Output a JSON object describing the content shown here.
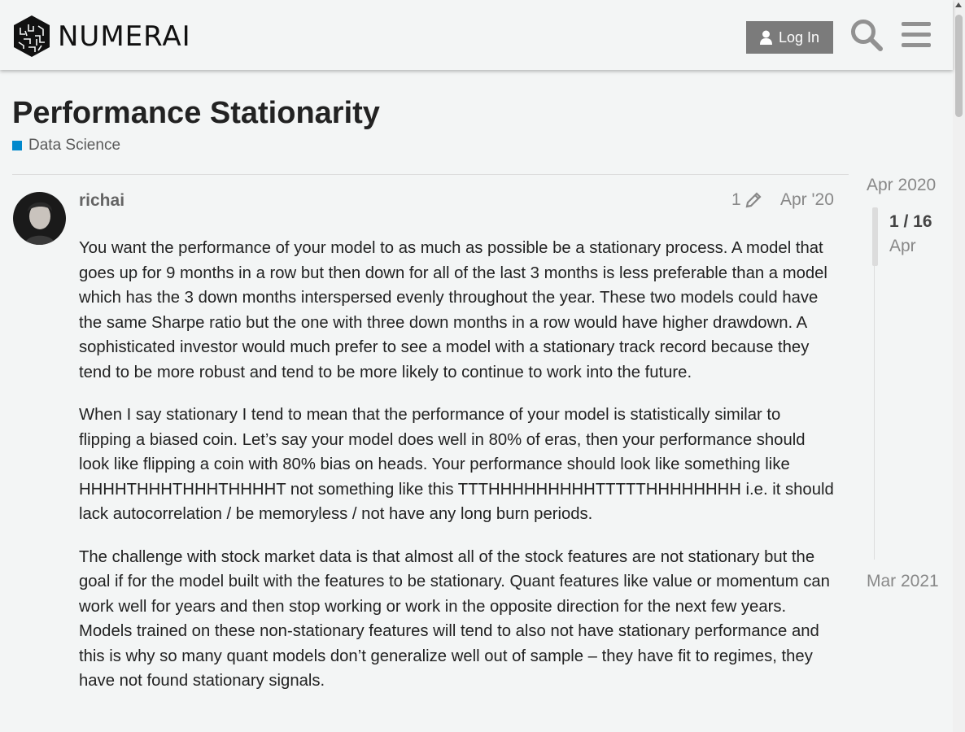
{
  "header": {
    "logo_text": "NUMERAI",
    "login_label": "Log In",
    "icons": [
      "user-icon",
      "search-icon",
      "menu-icon"
    ]
  },
  "topic": {
    "title": "Performance Stationarity",
    "category": "Data Science",
    "category_color": "#0088cc"
  },
  "post": {
    "username": "richai",
    "edit_count": "1",
    "date": "Apr '20",
    "paragraphs": [
      "You want the performance of your model to as much as possible be a stationary process. A model that goes up for 9 months in a row but then down for all of the last 3 months is less preferable than a model which has the 3 down months interspersed evenly throughout the year. These two models could have the same Sharpe ratio but the one with three down months in a row would have higher drawdown. A sophisticated investor would much prefer to see a model with a stationary track record because they tend to be more robust and tend to be more likely to continue to work into the future.",
      "When I say stationary I tend to mean that the performance of your model is statistically similar to flipping a biased coin. Let’s say your model does well in 80% of eras, then your performance should look like flipping a coin with 80% bias on heads. Your performance should look like something like HHHHTHHHTHHHTHHHHT not something like this TTTHHHHHHHHHTTTTTHHHHHHHH i.e. it should lack autocorrelation / be memoryless / not have any long burn periods.",
      "The challenge with stock market data is that almost all of the stock features are not stationary but the goal if for the model built with the features to be stationary. Quant features like value or momentum can work well for years and then stop working or work in the opposite direction for the next few years. Models trained on these non-stationary features will tend to also not have stationary performance and this is why so many quant models don’t generalize well out of sample – they have fit to regimes, they have not found stationary signals."
    ]
  },
  "timeline": {
    "start": "Apr 2020",
    "position": "1 / 16",
    "current_month": "Apr",
    "end": "Mar 2021"
  }
}
